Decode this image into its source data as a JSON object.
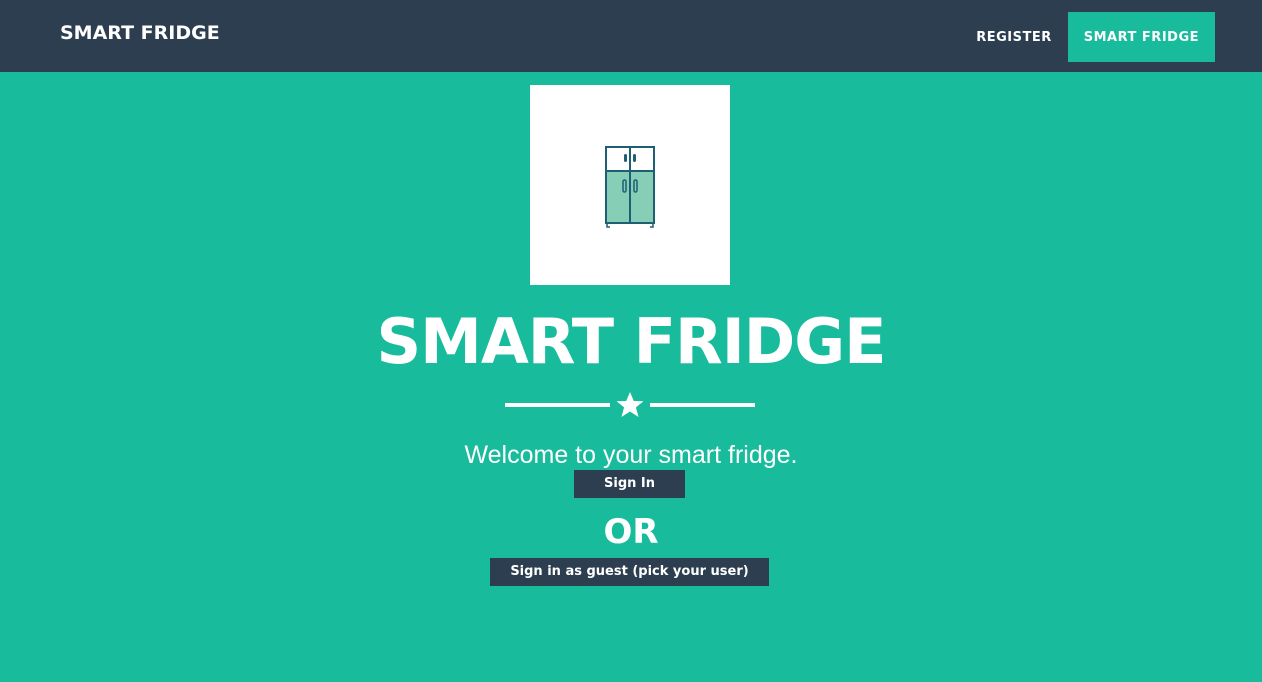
{
  "navbar": {
    "brand": "SMART FRIDGE",
    "links": [
      {
        "label": "REGISTER",
        "active": false
      },
      {
        "label": "SMART FRIDGE",
        "active": true
      }
    ]
  },
  "hero": {
    "logo_icon": "fridge-icon",
    "title": "SMART FRIDGE",
    "divider_icon": "star-icon",
    "welcome": "Welcome to your smart fridge.",
    "signin_label": "Sign In",
    "or_text": "OR",
    "guest_label": "Sign in as guest (pick your user)"
  },
  "colors": {
    "primary": "#18bc9c",
    "navbar": "#2c3e50",
    "button": "#2c3e50",
    "text": "#ffffff"
  }
}
